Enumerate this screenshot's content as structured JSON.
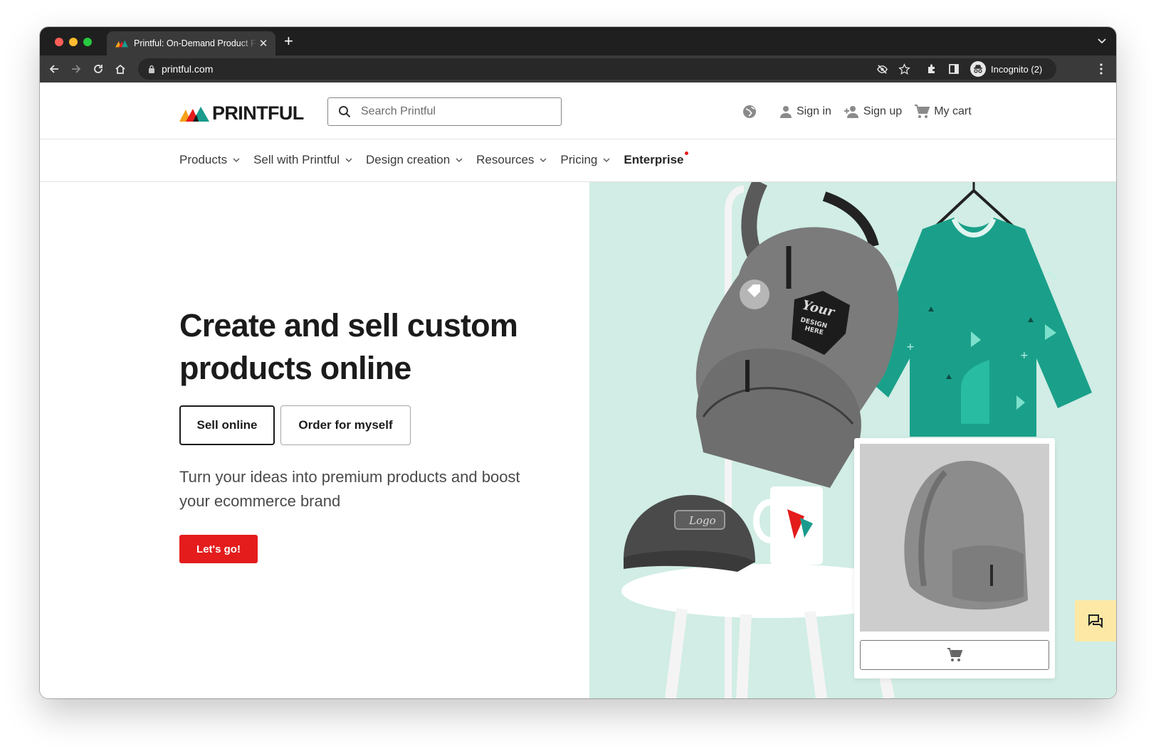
{
  "browser": {
    "tab_title": "Printful: On-Demand Product F",
    "url": "printful.com",
    "profile_label": "Incognito (2)"
  },
  "header": {
    "logo_text": "PRINTFUL",
    "search_placeholder": "Search Printful",
    "sign_in": "Sign in",
    "sign_up": "Sign up",
    "cart": "My cart"
  },
  "nav": {
    "items": [
      {
        "label": "Products"
      },
      {
        "label": "Sell with Printful"
      },
      {
        "label": "Design creation"
      },
      {
        "label": "Resources"
      },
      {
        "label": "Pricing"
      },
      {
        "label": "Enterprise"
      }
    ]
  },
  "hero": {
    "title": "Create and sell custom products online",
    "sell_button": "Sell online",
    "order_button": "Order for myself",
    "subtitle": "Turn your ideas into premium products and boost your ecommerce brand",
    "cta": "Let's go!"
  },
  "image_text": {
    "backpack_print": [
      "Your",
      "DESIGN",
      "HERE"
    ],
    "cap_print": "Logo"
  },
  "colors": {
    "brand_red": "#e41c1c",
    "hero_bg": "#d1ede5",
    "tshirt": "#1aa08a",
    "chat_widget": "#fde9a5"
  },
  "icons": [
    "back-icon",
    "forward-icon",
    "reload-icon",
    "home-icon",
    "lock-icon",
    "eye-off-icon",
    "star-icon",
    "extensions-icon",
    "sidepanel-icon",
    "incognito-icon",
    "menu-icon",
    "search-icon",
    "globe-icon",
    "user-icon",
    "user-plus-icon",
    "cart-icon",
    "chat-icon"
  ]
}
